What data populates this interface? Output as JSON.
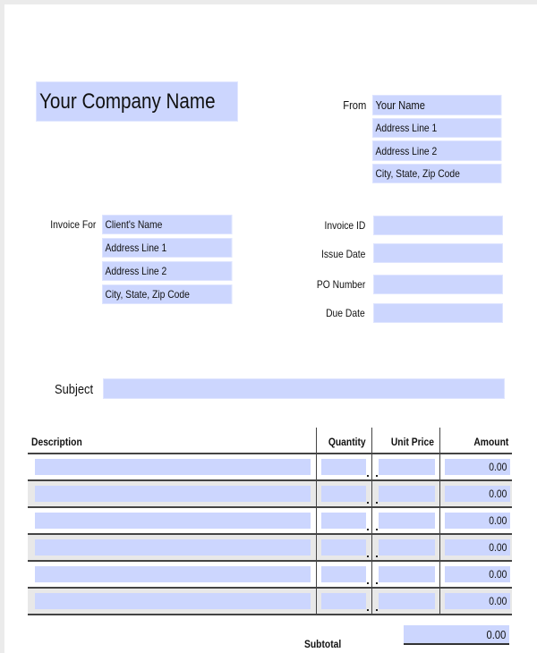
{
  "header": {
    "company_name": "Your Company Name",
    "from_label": "From",
    "from_fields": [
      "Your Name",
      "Address Line 1",
      "Address Line 2",
      "City, State, Zip Code"
    ]
  },
  "invoice_for": {
    "label": "Invoice For",
    "fields": [
      "Client's Name",
      "Address Line 1",
      "Address Line 2",
      "City, State, Zip Code"
    ]
  },
  "invoice_meta": [
    {
      "label": "Invoice ID",
      "value": ""
    },
    {
      "label": "Issue Date",
      "value": ""
    },
    {
      "label": "PO Number",
      "value": ""
    },
    {
      "label": "Due Date",
      "value": ""
    }
  ],
  "subject": {
    "label": "Subject",
    "value": ""
  },
  "table": {
    "columns": [
      "Description",
      "Quantity",
      "Unit Price",
      "Amount"
    ],
    "rows": [
      {
        "description": "",
        "quantity": "",
        "unit_price": "",
        "amount": "0.00"
      },
      {
        "description": "",
        "quantity": "",
        "unit_price": "",
        "amount": "0.00"
      },
      {
        "description": "",
        "quantity": "",
        "unit_price": "",
        "amount": "0.00"
      },
      {
        "description": "",
        "quantity": "",
        "unit_price": "",
        "amount": "0.00"
      },
      {
        "description": "",
        "quantity": "",
        "unit_price": "",
        "amount": "0.00"
      },
      {
        "description": "",
        "quantity": "",
        "unit_price": "",
        "amount": "0.00"
      }
    ]
  },
  "totals": {
    "subtotal_label": "Subtotal",
    "subtotal_value": "0.00"
  },
  "colors": {
    "field_fill": "#ccd6fe",
    "alt_row": "#e8e8e8",
    "page_bg": "#ebebeb"
  }
}
